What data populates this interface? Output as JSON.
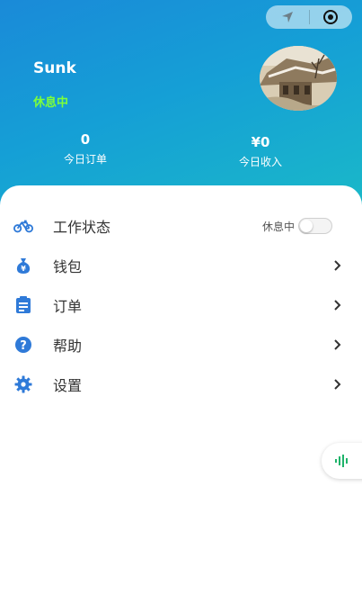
{
  "profile": {
    "username": "Sunk",
    "status": "休息中"
  },
  "stats": {
    "orders_value": "0",
    "orders_label": "今日订单",
    "income_value": "¥0",
    "income_label": "今日收入"
  },
  "menu": {
    "work_status": {
      "label": "工作状态",
      "toggle_label": "休息中",
      "toggle_on": false,
      "icon": "bicycle-icon"
    },
    "wallet": {
      "label": "钱包",
      "icon": "money-bag-icon"
    },
    "orders": {
      "label": "订单",
      "icon": "clipboard-icon"
    },
    "help": {
      "label": "帮助",
      "icon": "help-icon"
    },
    "settings": {
      "label": "设置",
      "icon": "gear-icon"
    }
  },
  "colors": {
    "header_gradient_start": "#1a8ad8",
    "header_gradient_end": "#1ab9c8",
    "status_green": "#7dff3a",
    "icon_blue": "#2f7ad8",
    "float_icon_green": "#1fb36a"
  }
}
